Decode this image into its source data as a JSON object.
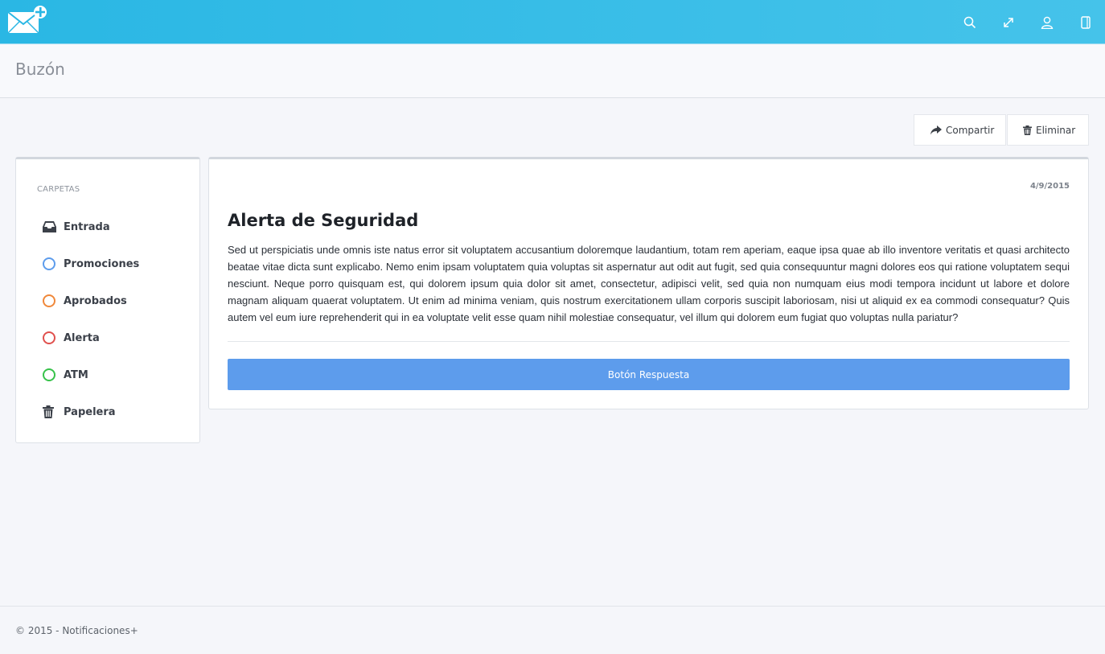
{
  "header": {
    "logo_icon": "mail-plus-icon",
    "icons": [
      "search-icon",
      "expand-icon",
      "user-icon",
      "tablet-icon"
    ]
  },
  "page": {
    "title": "Buzón"
  },
  "toolbar": {
    "share_label": "Compartir",
    "delete_label": "Eliminar"
  },
  "sidebar": {
    "heading": "CARPETAS",
    "items": [
      {
        "label": "Entrada",
        "icon": "inbox-icon",
        "color": "#3b4049"
      },
      {
        "label": "Promociones",
        "icon": "ring-icon",
        "color": "#5d9cec"
      },
      {
        "label": "Aprobados",
        "icon": "ring-icon",
        "color": "#f0883a"
      },
      {
        "label": "Alerta",
        "icon": "ring-icon",
        "color": "#e0504d"
      },
      {
        "label": "ATM",
        "icon": "ring-icon",
        "color": "#37c24a"
      },
      {
        "label": "Papelera",
        "icon": "trash-icon",
        "color": "#3b4049"
      }
    ]
  },
  "message": {
    "date": "4/9/2015",
    "title": "Alerta de Seguridad",
    "body": "Sed ut perspiciatis unde omnis iste natus error sit voluptatem accusantium doloremque laudantium, totam rem aperiam, eaque ipsa quae ab illo inventore veritatis et quasi architecto beatae vitae dicta sunt explicabo. Nemo enim ipsam voluptatem quia voluptas sit aspernatur aut odit aut fugit, sed quia consequuntur magni dolores eos qui ratione voluptatem sequi nesciunt. Neque porro quisquam est, qui dolorem ipsum quia dolor sit amet, consectetur, adipisci velit, sed quia non numquam eius modi tempora incidunt ut labore et dolore magnam aliquam quaerat voluptatem. Ut enim ad minima veniam, quis nostrum exercitationem ullam corporis suscipit laboriosam, nisi ut aliquid ex ea commodi consequatur? Quis autem vel eum iure reprehenderit qui in ea voluptate velit esse quam nihil molestiae consequatur, vel illum qui dolorem eum fugiat quo voluptas nulla pariatur?",
    "reply_label": "Botón Respuesta"
  },
  "footer": {
    "text": "© 2015 - Notificaciones+"
  },
  "colors": {
    "header_start": "#2ab7e4",
    "header_end": "#45c3ea",
    "reply_button": "#5d9cec"
  }
}
